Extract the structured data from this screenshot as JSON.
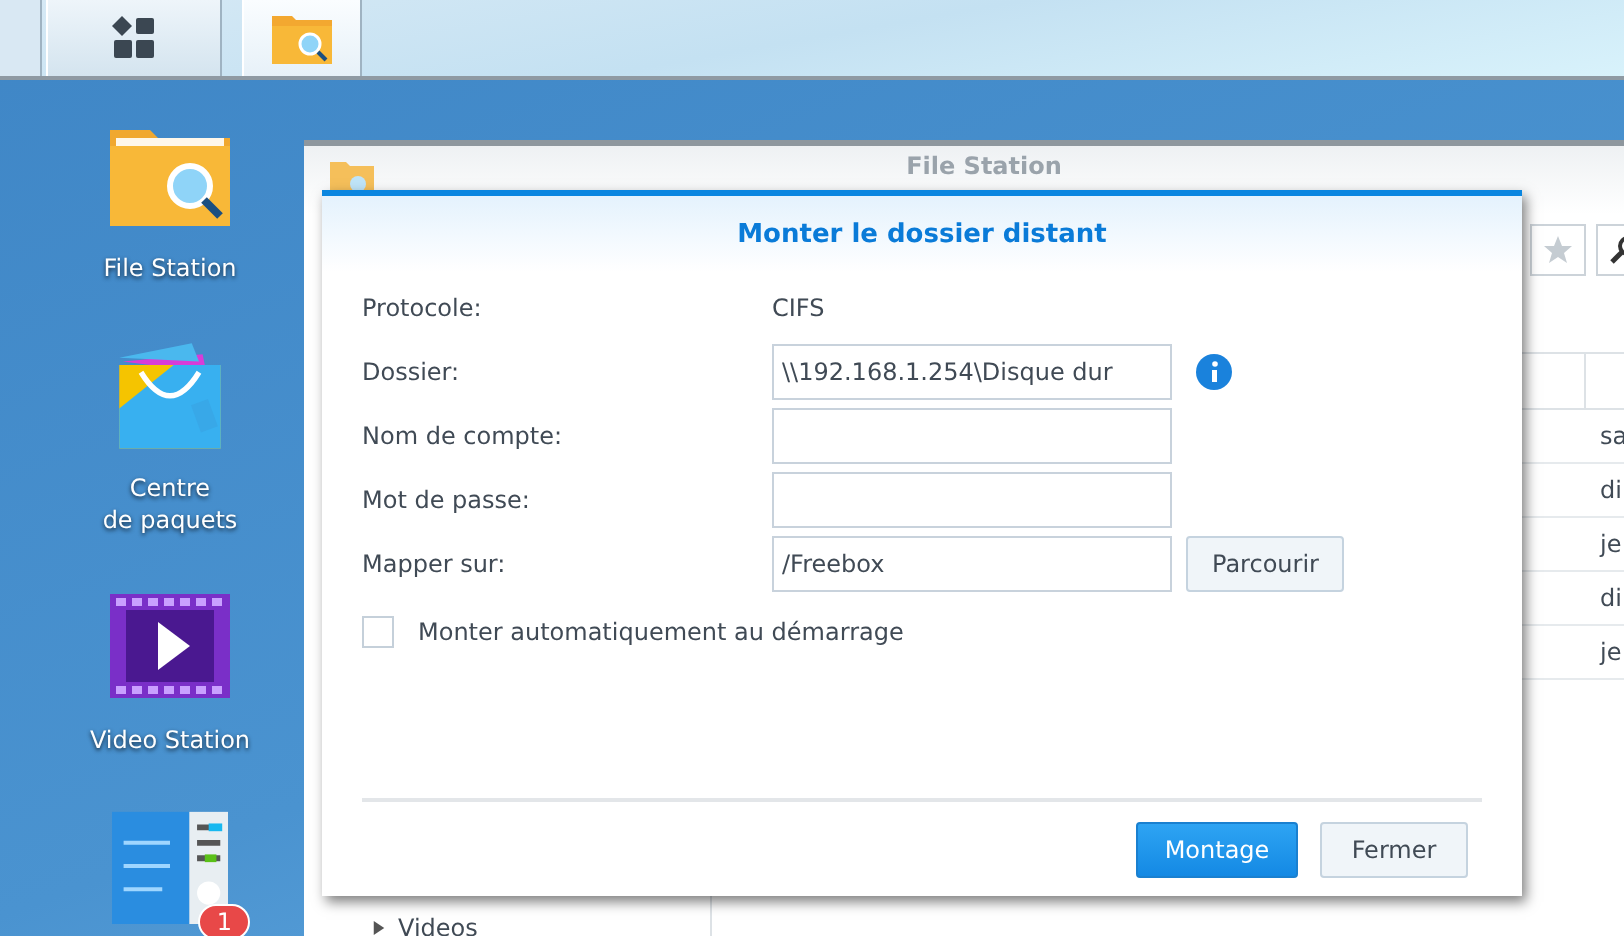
{
  "taskbar": {
    "items": [
      {
        "kind": "main-menu",
        "selected": false
      },
      {
        "kind": "file-station",
        "selected": true
      }
    ]
  },
  "desktop_icons": [
    {
      "kind": "file-station",
      "label": "File Station"
    },
    {
      "kind": "package",
      "label": "Centre\nde paquets"
    },
    {
      "kind": "video",
      "label": "Video Station"
    },
    {
      "kind": "checklist",
      "badge": "1"
    }
  ],
  "file_station": {
    "title": "File Station",
    "sidebar": {
      "items": [
        {
          "label": "Videos",
          "expanded": false
        }
      ]
    },
    "table": {
      "rows": [
        {
          "column_2": "sa"
        },
        {
          "column_2": "di"
        },
        {
          "column_2": "je"
        },
        {
          "column_2": "di"
        },
        {
          "column_2": "je"
        }
      ]
    }
  },
  "dialog": {
    "title": "Monter le dossier distant",
    "fields": [
      {
        "kind": "text",
        "label": "Protocole:",
        "value": "CIFS"
      },
      {
        "kind": "input",
        "label": "Dossier:",
        "value": "\\\\192.168.1.254\\Disque dur",
        "info": true
      },
      {
        "kind": "input",
        "label": "Nom de compte:"
      },
      {
        "kind": "input",
        "label": "Mot de passe:"
      },
      {
        "kind": "input",
        "label": "Mapper sur:",
        "value": "/Freebox",
        "button": "Parcourir"
      }
    ],
    "checkbox": {
      "label": "Monter automatiquement au démarrage",
      "checked": false
    },
    "buttons": [
      {
        "label": "Montage",
        "kind": "primary"
      },
      {
        "label": "Fermer",
        "kind": "secondary"
      }
    ]
  }
}
